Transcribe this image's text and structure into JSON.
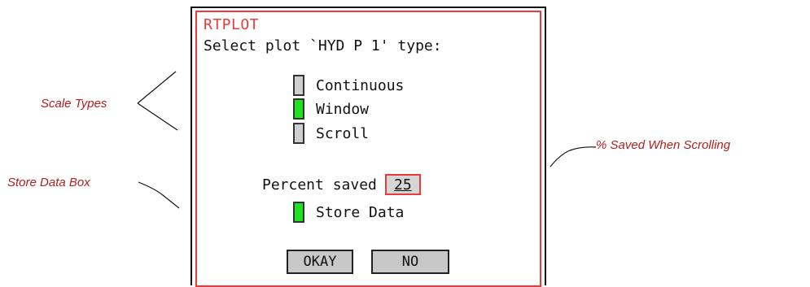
{
  "dialog": {
    "title": "RTPLOT",
    "prompt": "Select plot `HYD P 1' type:",
    "scale_options": [
      {
        "label": "Continuous",
        "selected": false
      },
      {
        "label": "Window",
        "selected": true
      },
      {
        "label": "Scroll",
        "selected": false
      }
    ],
    "percent_label": "Percent saved",
    "percent_value": "25",
    "store_data_label": "Store Data",
    "store_data_checked": true,
    "okay_label": "OKAY",
    "no_label": "NO"
  },
  "callouts": {
    "scale_types": "Scale Types",
    "store_data_box": "Store Data Box",
    "percent_saved": "% Saved When Scrolling"
  },
  "colors": {
    "accent_red": "#e83c3c",
    "on_green": "#22e022",
    "off_gray": "#cfcfcf",
    "callout_text": "#b02020"
  }
}
